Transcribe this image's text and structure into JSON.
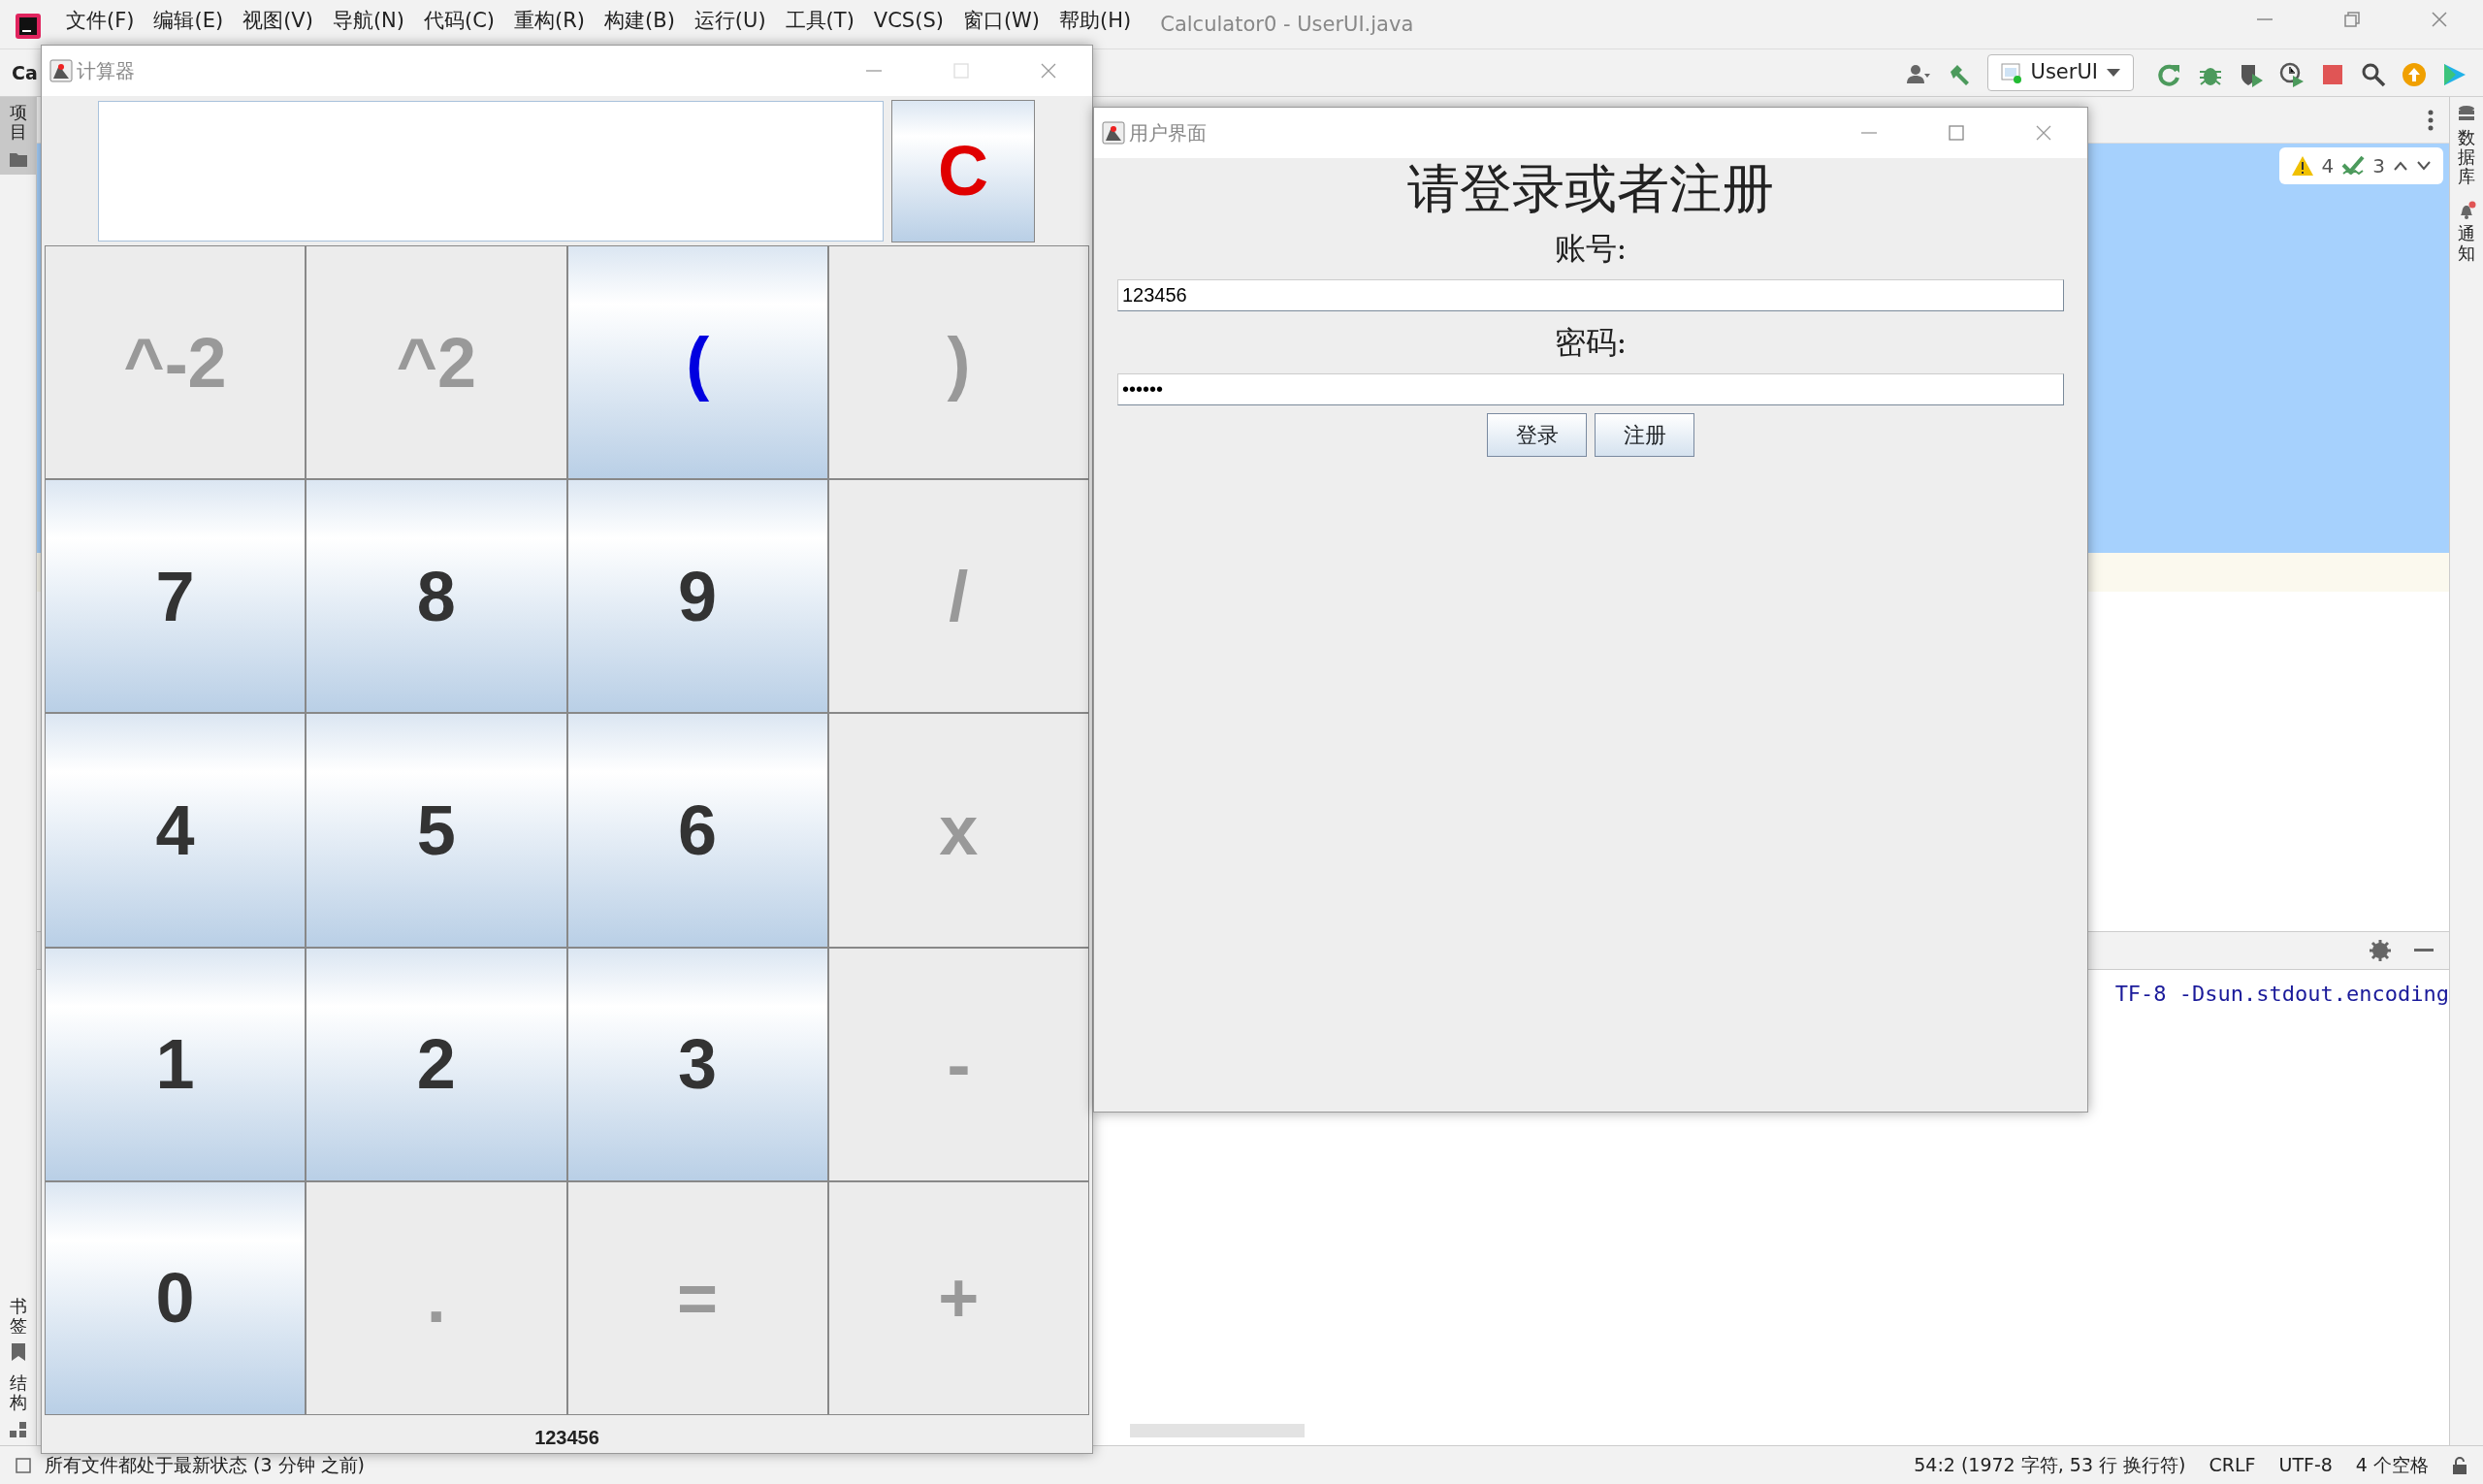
{
  "ide": {
    "menu": [
      "文件(F)",
      "编辑(E)",
      "视图(V)",
      "导航(N)",
      "代码(C)",
      "重构(R)",
      "构建(B)",
      "运行(U)",
      "工具(T)",
      "VCS(S)",
      "窗口(W)",
      "帮助(H)"
    ],
    "title": "Calculator0 - UserUI.java",
    "toolbar_text": "Ca",
    "run_config": "UserUI",
    "left_tools": [
      {
        "label": "项目",
        "selected": true
      },
      {
        "label": "书签",
        "selected": false
      },
      {
        "label": "结构",
        "selected": false
      }
    ],
    "right_tools": [
      {
        "label": "数据库",
        "kind": "database"
      },
      {
        "label": "通知",
        "kind": "bell"
      }
    ],
    "inspections": {
      "warnings": "4",
      "passed": "3"
    },
    "console_line": "TF-8 -Dsun.stdout.encoding",
    "status": {
      "message": "所有文件都处于最新状态 (3 分钟 之前)",
      "items": [
        "54:2 (1972 字符, 53 行 换行符)",
        "CRLF",
        "UTF-8",
        "4 个空格"
      ]
    }
  },
  "calculator": {
    "title": "计算器",
    "clear_key": "C",
    "keys": [
      {
        "label": "^-2",
        "kind": "operator"
      },
      {
        "label": "^2",
        "kind": "operator"
      },
      {
        "label": "(",
        "kind": "highlight"
      },
      {
        "label": ")",
        "kind": "operator"
      },
      {
        "label": "7",
        "kind": "digit"
      },
      {
        "label": "8",
        "kind": "digit"
      },
      {
        "label": "9",
        "kind": "digit"
      },
      {
        "label": "/",
        "kind": "operator"
      },
      {
        "label": "4",
        "kind": "digit"
      },
      {
        "label": "5",
        "kind": "digit"
      },
      {
        "label": "6",
        "kind": "digit"
      },
      {
        "label": "x",
        "kind": "operator"
      },
      {
        "label": "1",
        "kind": "digit"
      },
      {
        "label": "2",
        "kind": "digit"
      },
      {
        "label": "3",
        "kind": "digit"
      },
      {
        "label": "-",
        "kind": "operator"
      },
      {
        "label": "0",
        "kind": "digit"
      },
      {
        "label": ".",
        "kind": "operator"
      },
      {
        "label": "=",
        "kind": "operator"
      },
      {
        "label": "+",
        "kind": "operator"
      }
    ],
    "result": "123456"
  },
  "login": {
    "title": "用户界面",
    "heading": "请登录或者注册",
    "account_label": "账号:",
    "account": "123456",
    "password_label": "密码:",
    "password": "••••••",
    "buttons": [
      "登录",
      "注册"
    ]
  }
}
